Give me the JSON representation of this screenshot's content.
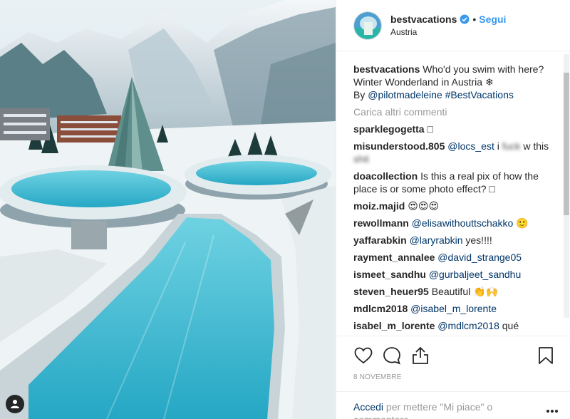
{
  "post": {
    "username": "bestvacations",
    "follow_label": "Segui",
    "dot": "•",
    "location": "Austria",
    "caption": {
      "username": "bestvacations",
      "text_1": "Who'd you swim with here? Winter Wonderland in Austria ❄",
      "by_label": "By",
      "mention": "@pilotmadeleine",
      "hashtag": "#BestVacations"
    },
    "load_more_label": "Carica altri commenti",
    "comments": [
      {
        "user": "sparklegogetta",
        "text": "□",
        "mention": ""
      },
      {
        "user": "misunderstood.805",
        "mention": "@locs_est",
        "text": "i",
        "censored": "fuck",
        "text_after": "w this",
        "censored_2": "shit"
      },
      {
        "user": "doacollection",
        "text": "Is this a real pix of how the place is or some photo effect? □",
        "mention": ""
      },
      {
        "user": "moiz.majid",
        "text": "😍😍😍",
        "mention": ""
      },
      {
        "user": "rewollmann",
        "mention": "@elisawithouttschakko",
        "text": "🙂"
      },
      {
        "user": "yaffarabkin",
        "mention": "@laryrabkin",
        "text": "yes!!!!"
      },
      {
        "user": "rayment_annalee",
        "mention": "@david_strange05",
        "text": ""
      },
      {
        "user": "ismeet_sandhu",
        "mention": "@gurbaljeet_sandhu",
        "text": ""
      },
      {
        "user": "steven_heuer95",
        "text": "Beautiful 👏🙌",
        "mention": ""
      },
      {
        "user": "mdlcm2018",
        "mention": "@isabel_m_lorente",
        "text": ""
      },
      {
        "user": "isabel_m_lorente",
        "mention": "@mdlcm2018",
        "text": "qué"
      }
    ],
    "date": "8 novembre",
    "login_link": "Accedi",
    "login_text": "per mettere \"Mi piace\" o commentare."
  },
  "icons": {
    "like": "heart-icon",
    "comment": "comment-icon",
    "share": "share-icon",
    "save": "bookmark-icon",
    "more": "more-options-icon",
    "verified": "verified-badge-icon",
    "tagged": "user-tag-icon"
  },
  "colors": {
    "link": "#003569",
    "follow": "#3897f0",
    "muted": "#999999",
    "pool": "#4fc3d9"
  }
}
